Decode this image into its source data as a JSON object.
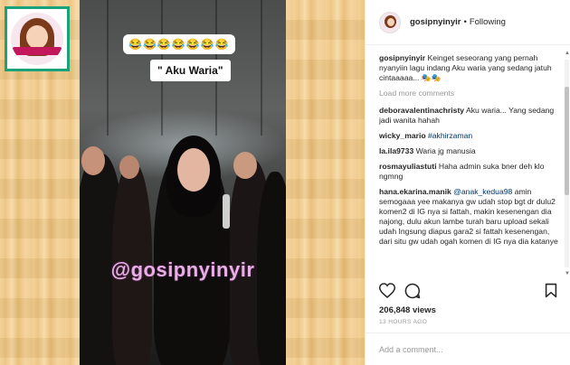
{
  "post": {
    "username": "gosipnyinyir",
    "separator": "•",
    "follow_status": "Following",
    "views": "206,848 views",
    "time_ago": "13 HOURS AGO",
    "add_comment_placeholder": "Add a comment...",
    "load_more": "Load more comments"
  },
  "media": {
    "emoji_row": "😂😂😂😂😂😂😂",
    "caption_text": "\" Aku Waria\"",
    "watermark": "@gosipnyinyir",
    "logo_label": "gosipnyinyir"
  },
  "comments": [
    {
      "user": "gosipnyinyir",
      "text": "Keinget seseorang yang pernah nyanyiin lagu indang Aku waria yang sedang jatuh cintaaaaa... 🎭🎭"
    },
    {
      "user": "deboravalentinachristy",
      "text": "Aku waria... Yang sedang jadi wanita hahah"
    },
    {
      "user": "wicky_mario",
      "text": "#akhirzaman"
    },
    {
      "user": "la.ila9733",
      "text": "Waria jg manusia"
    },
    {
      "user": "rosmayuliastuti",
      "text": "Haha admin suka bner deh klo ngmng"
    },
    {
      "user": "hana.ekarina.manik",
      "mention": "@anak_kedua98",
      "text": "amin semogaaa yee makanya gw udah stop bgt dr dulu2 komen2 di IG nya si fattah, makin kesenengan dia najong, dulu akun lambe turah baru upload sekali udah Ingsung diapus gara2 si fattah kesenengan, dari situ gw udah ogah komen di IG nya dia katanye"
    }
  ],
  "colors": {
    "video_bg": "#3c3e3d",
    "watermark": "#e6b0e4",
    "logo_border": "#1aa37a"
  },
  "icons": [
    "heart-icon",
    "comment-icon",
    "bookmark-icon",
    "scroll-up-icon",
    "scroll-down-icon"
  ]
}
